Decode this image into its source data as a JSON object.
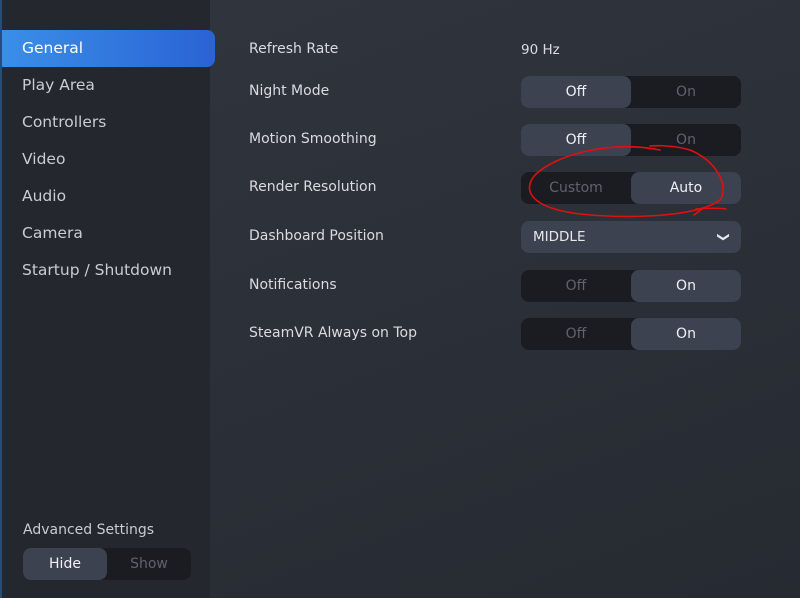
{
  "sidebar": {
    "items": [
      {
        "label": "General",
        "active": true
      },
      {
        "label": "Play Area"
      },
      {
        "label": "Controllers"
      },
      {
        "label": "Video"
      },
      {
        "label": "Audio"
      },
      {
        "label": "Camera"
      },
      {
        "label": "Startup / Shutdown"
      }
    ],
    "advanced": {
      "label": "Advanced Settings",
      "options": [
        "Hide",
        "Show"
      ],
      "selected": "Hide"
    }
  },
  "settings": {
    "refresh_rate": {
      "label": "Refresh Rate",
      "value": "90 Hz"
    },
    "night_mode": {
      "label": "Night Mode",
      "options": [
        "Off",
        "On"
      ],
      "selected": "Off"
    },
    "motion_smoothing": {
      "label": "Motion Smoothing",
      "options": [
        "Off",
        "On"
      ],
      "selected": "Off"
    },
    "render_resolution": {
      "label": "Render Resolution",
      "options": [
        "Custom",
        "Auto"
      ],
      "selected": "Auto"
    },
    "dashboard_position": {
      "label": "Dashboard Position",
      "value": "MIDDLE",
      "icon": "chevron-down-icon"
    },
    "notifications": {
      "label": "Notifications",
      "options": [
        "Off",
        "On"
      ],
      "selected": "On"
    },
    "always_on_top": {
      "label": "SteamVR Always on Top",
      "options": [
        "Off",
        "On"
      ],
      "selected": "On"
    }
  },
  "colors": {
    "accent": "#3a8ee8",
    "annotation": "#e01010"
  }
}
